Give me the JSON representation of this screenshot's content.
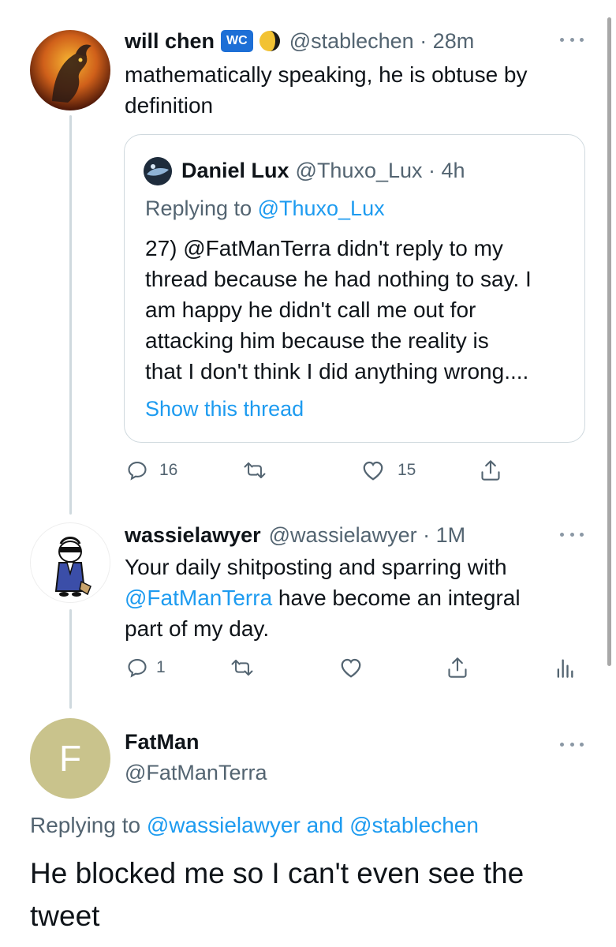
{
  "tweet1": {
    "name": "will chen",
    "badge": "WC",
    "handle_time": "@stablechen · 28m",
    "text": "mathematically speaking, he is obtuse by definition",
    "text_line1": "mathematically speaking, he is obtuse by",
    "text_line2": "definition",
    "quote": {
      "name": "Daniel Lux",
      "handle_time": "@Thuxo_Lux · 4h",
      "replying_prefix": "Replying to ",
      "replying_handle": "@Thuxo_Lux",
      "lines": [
        "27) @FatManTerra didn't reply to my",
        "thread because he had nothing to say. I",
        "am happy he didn't call me out for",
        "attacking him because the reality is",
        "that I don't think I did anything wrong...."
      ],
      "show_thread": "Show this thread"
    },
    "replies": "16",
    "likes": "15"
  },
  "tweet2": {
    "name": "wassielawyer",
    "handle_time": "@wassielawyer · 1M",
    "line1": "Your daily shitposting and sparring with",
    "line2_link": "@FatManTerra",
    "line2_rest": " have become an integral",
    "line3": "part of my day.",
    "replies": "1"
  },
  "main_tweet": {
    "avatar_letter": "F",
    "name": "FatMan",
    "handle": "@FatManTerra",
    "replying_prefix": "Replying to ",
    "replying_handles": "@wassielawyer and @stablechen",
    "text_line1": "He blocked me so I can't even see the",
    "text_line2": "tweet"
  },
  "colors": {
    "accent": "#1d9bf0",
    "secondary_text": "#536471",
    "border": "#cfd9de",
    "fatman_avatar": "#c9c38c"
  },
  "icons": [
    "reply-icon",
    "retweet-icon",
    "like-icon",
    "share-icon",
    "analytics-icon",
    "more-icon",
    "moon-icon",
    "wc-badge"
  ]
}
